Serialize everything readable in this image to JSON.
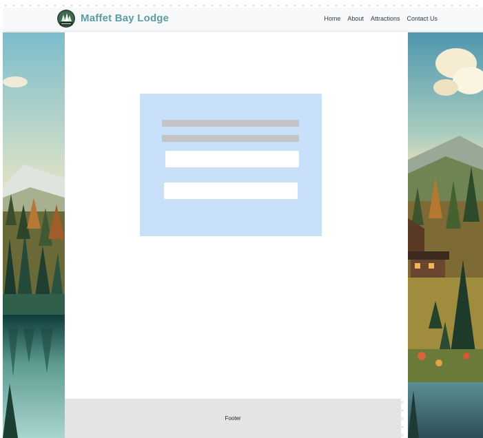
{
  "brand": {
    "name": "Maffet Bay Lodge",
    "logo_icon": "lodge-logo-icon"
  },
  "nav": {
    "items": [
      {
        "label": "Home"
      },
      {
        "label": "About"
      },
      {
        "label": "Attractions"
      },
      {
        "label": "Contact Us"
      }
    ]
  },
  "form": {
    "field_1_value": "",
    "field_2_value": ""
  },
  "footer": {
    "text": "Footer"
  },
  "colors": {
    "brand_teal": "#5b9ea1",
    "header_bg": "#f7f8f9",
    "form_card_bg": "#c8e0f9",
    "skeleton_gray": "#c4c4c4",
    "footer_bg": "#e4e4e4"
  }
}
